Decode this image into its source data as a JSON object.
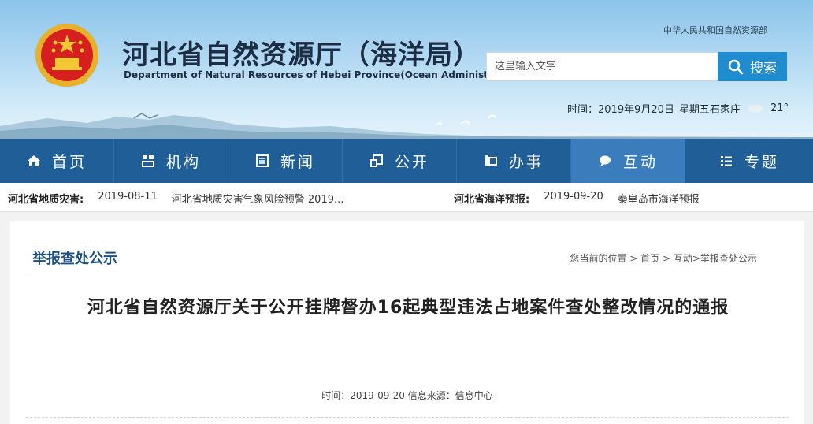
{
  "header": {
    "site_title": "河北省自然资源厅（海洋局）",
    "site_subtitle": "Department of Natural Resources of Hebei Province(Ocean  Administration)",
    "ministry_link": "中华人民共和国自然资源部",
    "search": {
      "placeholder": "这里输入文字",
      "button_label": "搜索"
    },
    "datetime": {
      "label": "时间：",
      "date": "2019年9月20日",
      "weekday": "星期五",
      "city": "石家庄",
      "temperature": "21°"
    }
  },
  "nav": {
    "items": [
      {
        "label": "首页",
        "icon": "home-icon"
      },
      {
        "label": "机构",
        "icon": "org-icon"
      },
      {
        "label": "新闻",
        "icon": "news-icon"
      },
      {
        "label": "公开",
        "icon": "public-icon"
      },
      {
        "label": "办事",
        "icon": "service-icon"
      },
      {
        "label": "互动",
        "icon": "chat-icon"
      },
      {
        "label": "专题",
        "icon": "list-icon"
      }
    ],
    "active_index": 5
  },
  "ticker": {
    "left": {
      "label": "河北省地质灾害:",
      "date": "2019-08-11",
      "text": "河北省地质灾害气象风险预警 2019..."
    },
    "right": {
      "label": "河北省海洋预报:",
      "date": "2019-09-20",
      "text": "秦皇岛市海洋预报"
    }
  },
  "content": {
    "section_title": "举报查处公示",
    "breadcrumb": {
      "prefix": "您当前的位置",
      "sep": ">",
      "home": "首页",
      "interact": "互动",
      "current": "举报查处公示"
    },
    "article_title": "河北省自然资源厅关于公开挂牌督办16起典型违法占地案件查处整改情况的通报",
    "meta": {
      "time_label": "时间：",
      "time": "2019-09-20",
      "source_label": "信息来源：",
      "source": "信息中心"
    }
  },
  "colors": {
    "nav_bg": "#1f5e97",
    "nav_active": "#3a7cbc",
    "search_button": "#1e8ccf",
    "section_title": "#1c4f82"
  }
}
